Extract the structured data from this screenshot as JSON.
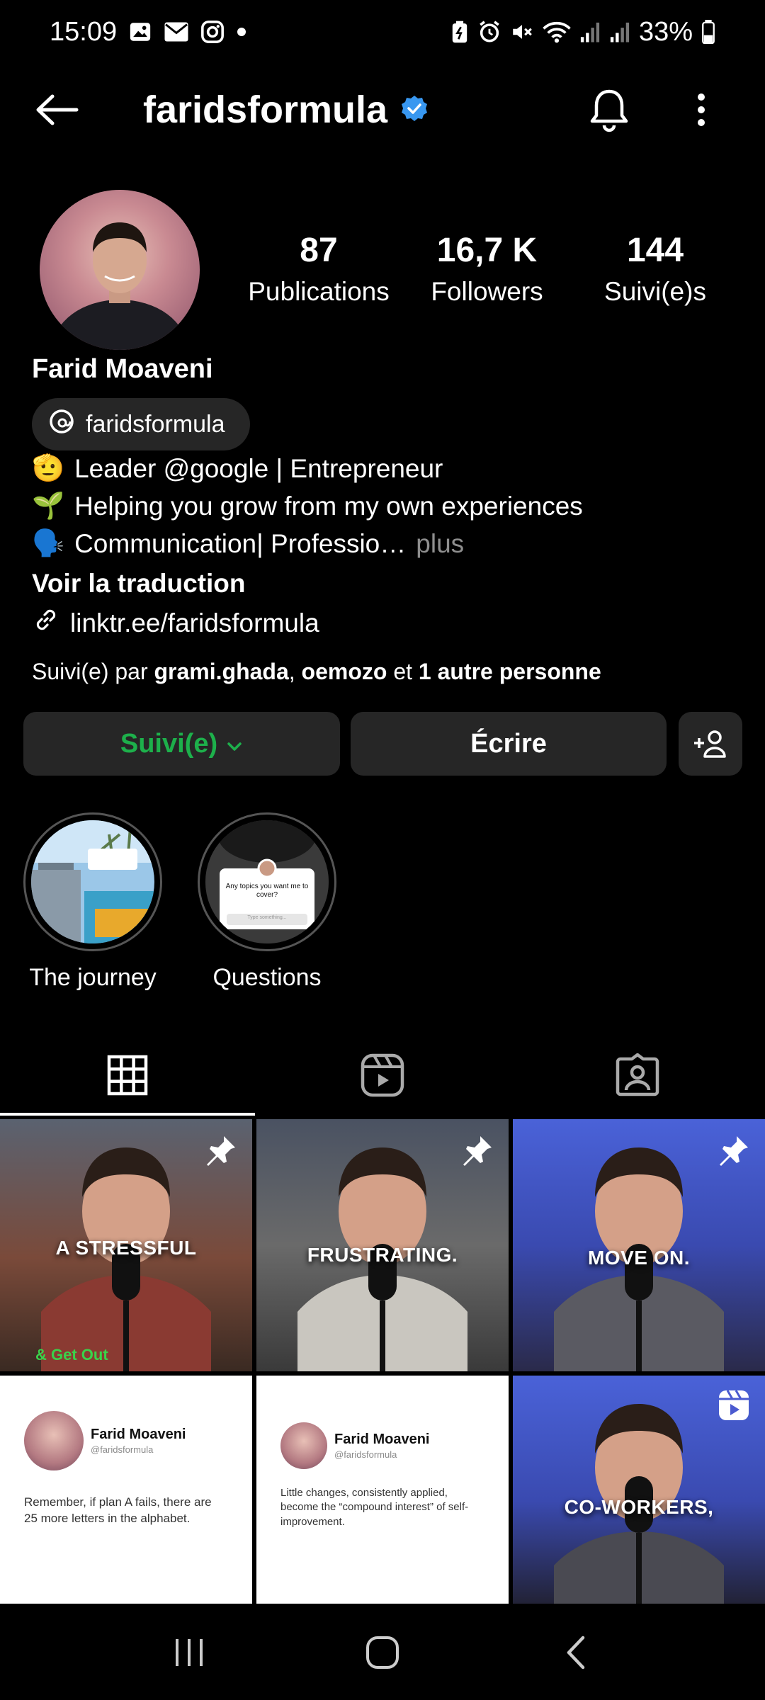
{
  "status_bar": {
    "time": "15:09",
    "battery": "33%",
    "left_icons": [
      "gallery-icon",
      "mail-icon",
      "instagram-icon",
      "dot-icon"
    ],
    "right_icons": [
      "battery-saver-icon",
      "alarm-icon",
      "mute-icon",
      "wifi-icon",
      "signal-icon",
      "signal-icon",
      "battery-icon"
    ]
  },
  "header": {
    "username": "faridsformula",
    "verified": true
  },
  "profile": {
    "stats": [
      {
        "value": "87",
        "label": "Publications"
      },
      {
        "value": "16,7 K",
        "label": "Followers"
      },
      {
        "value": "144",
        "label": "Suivi(e)s"
      }
    ],
    "full_name": "Farid Moaveni",
    "threads_handle": "faridsformula",
    "bio": [
      {
        "emoji": "🫡",
        "text": "Leader @google | Entrepreneur"
      },
      {
        "emoji": "🌱",
        "text": "Helping you grow from my own experiences"
      },
      {
        "emoji": "🗣️",
        "text": "Communication| Professio…",
        "more": "plus"
      }
    ],
    "translate_label": "Voir la traduction",
    "link": "linktr.ee/faridsformula",
    "followed_by": {
      "prefix": "Suivi(e) par",
      "user1": "grami.ghada",
      "sep": ",",
      "user2": "oemozo",
      "mid": "et",
      "others": "1 autre personne"
    }
  },
  "actions": {
    "follow_label": "Suivi(e)",
    "message_label": "Écrire"
  },
  "highlights": [
    {
      "label": "The journey"
    },
    {
      "label": "Questions",
      "card_text": "Any topics you want me to cover?",
      "card_placeholder": "Type something..."
    }
  ],
  "tabs": [
    "grid-icon",
    "reels-icon",
    "tagged-icon"
  ],
  "posts": [
    {
      "type": "video",
      "caption": "A STRESSFUL",
      "pinned": true,
      "subcaption": "& Get Out"
    },
    {
      "type": "video",
      "caption": "FRUSTRATING.",
      "pinned": true
    },
    {
      "type": "video",
      "caption": "MOVE ON.",
      "pinned": true
    },
    {
      "type": "text",
      "name": "Farid Moaveni",
      "handle": "@faridsformula",
      "text": "Remember, if plan A fails, there are 25 more letters in the alphabet."
    },
    {
      "type": "text",
      "name": "Farid Moaveni",
      "handle": "@faridsformula",
      "text": "Little changes, consistently applied, become the “compound interest” of self-improvement."
    },
    {
      "type": "video",
      "caption": "CO-WORKERS,",
      "reel": true
    }
  ],
  "colors": {
    "background": "#000000",
    "button": "#262626",
    "follow_green": "#1db04b",
    "verified_blue": "#3897f0",
    "muted": "#8e8e8e"
  }
}
